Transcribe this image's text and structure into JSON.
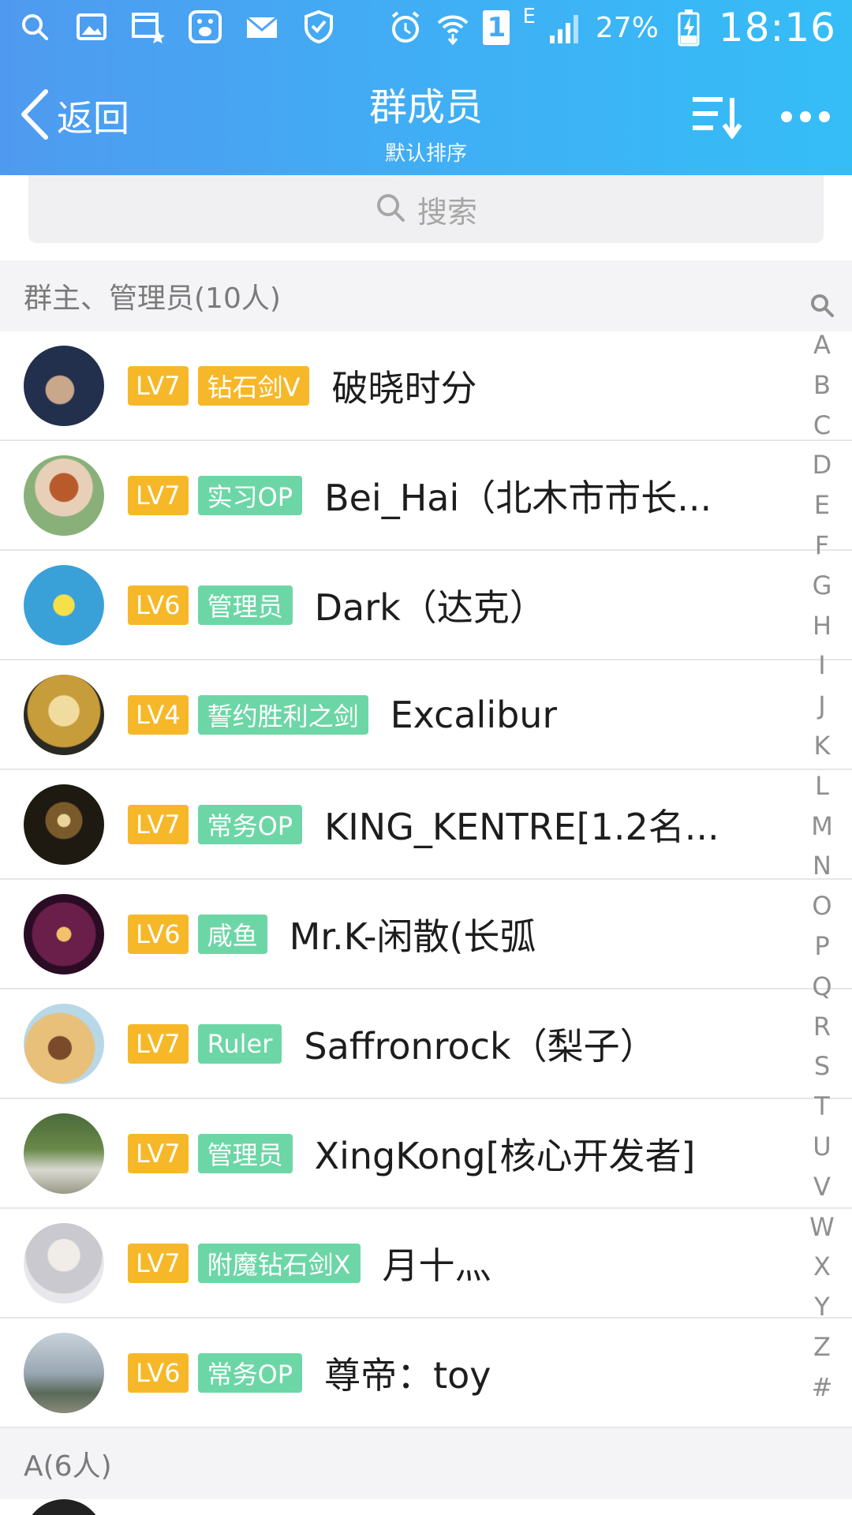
{
  "status_bar": {
    "left_icons": [
      "search-icon",
      "image-icon",
      "calendar-icon",
      "baidu-icon",
      "mail-icon",
      "shield-icon"
    ],
    "alarm_icon": "alarm-icon",
    "wifi_icon": "wifi-icon",
    "sim_label": "1",
    "network_type": "E",
    "battery_percent": "27%",
    "time": "18:16"
  },
  "navbar": {
    "back_label": "返回",
    "title": "群成员",
    "subtitle": "默认排序",
    "sort_icon": "sort-icon",
    "more_icon": "more-icon"
  },
  "search": {
    "placeholder": "搜索"
  },
  "sections": [
    {
      "label": "群主、管理员(10人)",
      "members": [
        {
          "level": "LV7",
          "title": "钻石剑V",
          "name": "破晓时分",
          "avatar_color": "#1c2b4a"
        },
        {
          "level": "LV7",
          "title": "实习OP",
          "name": "Bei_Hai（北木市市长...",
          "avatar_color": "#8ab07a"
        },
        {
          "level": "LV6",
          "title": "管理员",
          "name": "Dark（达克）",
          "avatar_color": "#3aa0d8"
        },
        {
          "level": "LV4",
          "title": "誓约胜利之剑",
          "name": "Excalibur",
          "avatar_color": "#c79c3a"
        },
        {
          "level": "LV7",
          "title": "常务OP",
          "name": "KING_KENTRE[1.2名...",
          "avatar_color": "#2b2418"
        },
        {
          "level": "LV6",
          "title": "咸鱼",
          "name": "Mr.K-闲散(长弧",
          "avatar_color": "#4a1a3a"
        },
        {
          "level": "LV7",
          "title": "Ruler",
          "name": "Saffronrock（梨子）",
          "avatar_color": "#d2a25a"
        },
        {
          "level": "LV7",
          "title": "管理员",
          "name": "XingKong[核心开发者]",
          "avatar_color": "#6a8a4a"
        },
        {
          "level": "LV7",
          "title": "附魔钻石剑X",
          "name": "月十灬",
          "avatar_color": "#c9c9cf"
        },
        {
          "level": "LV6",
          "title": "常务OP",
          "name": "尊帝：toy",
          "avatar_color": "#8a9aa8"
        }
      ]
    },
    {
      "label": "A(6人)",
      "members": []
    }
  ],
  "alphabet_index": [
    "A",
    "B",
    "C",
    "D",
    "E",
    "F",
    "G",
    "H",
    "I",
    "J",
    "K",
    "L",
    "M",
    "N",
    "O",
    "P",
    "Q",
    "R",
    "S",
    "T",
    "U",
    "V",
    "W",
    "X",
    "Y",
    "Z",
    "#"
  ],
  "colors": {
    "header_start": "#4f9af0",
    "header_end": "#35bdf6",
    "level_badge": "#f6b829",
    "title_badge": "#6dd6a6"
  }
}
